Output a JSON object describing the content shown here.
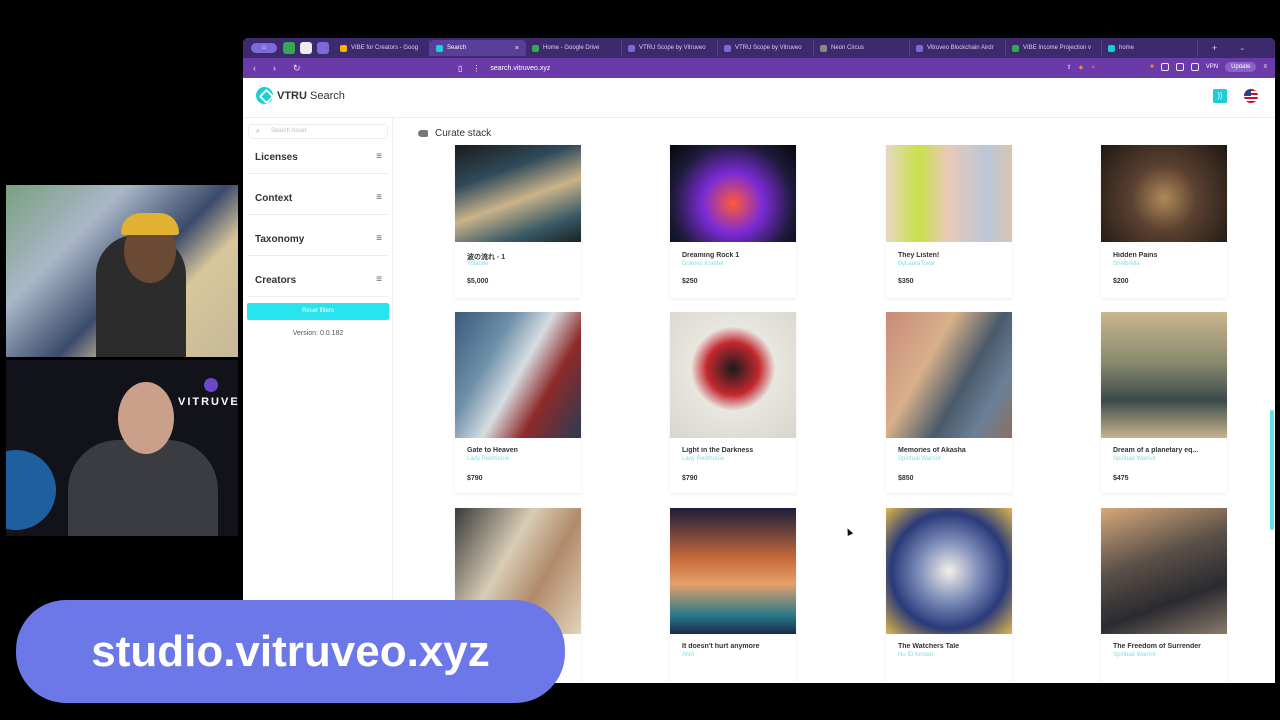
{
  "browser": {
    "win_label": "⌂",
    "tabs": [
      {
        "label": "VIBE for Creators - Goog",
        "color": "#f4b400"
      },
      {
        "label": "Search",
        "color": "#1ccdd8",
        "active": true
      },
      {
        "label": "Home - Google Drive",
        "color": "#34a853"
      },
      {
        "label": "VTRU Scope by Vitruveo",
        "color": "#7b6ad8"
      },
      {
        "label": "VTRU Scope by Vitruveo",
        "color": "#7b6ad8"
      },
      {
        "label": "Neon Circus",
        "color": "#888888"
      },
      {
        "label": "Vitruveo Blockchain Airdr",
        "color": "#7b6ad8"
      },
      {
        "label": "VIBE Income Projection v",
        "color": "#34a853"
      },
      {
        "label": "home",
        "color": "#1ccdd8"
      }
    ],
    "url": "search.vitruveo.xyz",
    "vpn_label": "VPN",
    "update_label": "Update"
  },
  "header": {
    "brand_bold": "VTRU",
    "brand_rest": " Search"
  },
  "sidebar": {
    "search_placeholder": "Search Asset",
    "facets": [
      "Licenses",
      "Context",
      "Taxonomy",
      "Creators"
    ],
    "reset_label": "Reset filters",
    "version": "Version: 0.0.182"
  },
  "main": {
    "curate_label": "Curate stack",
    "cards": [
      {
        "title": "波の流れ - 1",
        "creator": "Yolande",
        "price": "$5,000",
        "art": "linear-gradient(160deg,#1b1b1b 0%,#2f4a5a 30%,#c9b38a 55%,#3a5a66 80%,#1a2226 100%)"
      },
      {
        "title": "Dreaming Rock 1",
        "creator": "Dolores Krantel",
        "price": "$250",
        "art": "radial-gradient(circle at 50% 60%,#ff5a3a 0%,#7b2bd6 35%,#1d1b3a 70%,#05060f 100%)"
      },
      {
        "title": "They Listen!",
        "creator": "ByLauraTovar",
        "price": "$350",
        "art": "linear-gradient(90deg,#e7d7c5 0%,#c9e04a 25%,#e8c9b8 50%,#bcc6d8 80%,#d9c6b2 100%)"
      },
      {
        "title": "Hidden Pains",
        "creator": "Shelbrella",
        "price": "$200",
        "art": "radial-gradient(circle at 50% 55%,#b08a5a 0%,#5a4030 40%,#1e1812 100%)"
      },
      {
        "title": "Gate to Heaven",
        "creator": "Lady Redmonie",
        "price": "$790",
        "art": "linear-gradient(120deg,#3a5a7a 0%,#6d8fa8 30%,#d6dde2 50%,#8e2a2a 70%,#2a3b52 100%)"
      },
      {
        "title": "Light in the Darkness",
        "creator": "Lady Redmonie",
        "price": "$790",
        "art": "radial-gradient(circle at 50% 45%,#1b1b1b 0%,#c3282e 28%,#e9e6e0 45%,#d8d5cf 100%)"
      },
      {
        "title": "Memories of Akasha",
        "creator": "Spiritual Warrior",
        "price": "$850",
        "art": "linear-gradient(120deg,#c98a7a 0%,#d8b08a 35%,#4a5a6a 60%,#6a8098 80%,#8a7060 100%)"
      },
      {
        "title": "Dream of a planetary eq...",
        "creator": "Spiritual Warrior",
        "price": "$475",
        "art": "linear-gradient(180deg,#c9b68e 0%,#8a8a6e 40%,#3a4a4a 70%,#c8b490 100%)"
      },
      {
        "title": "",
        "creator": "",
        "price": "",
        "art": "linear-gradient(120deg,#3a3a3a 0%,#d8cdb5 40%,#b08a6a 65%,#e2d4bb 100%)"
      },
      {
        "title": "It doesn't hurt anymore",
        "creator": "ANA",
        "price": "",
        "art": "linear-gradient(180deg,#1b1e3a 0%,#c86a3a 40%,#e5a06a 60%,#2a7a8a 85%,#1a2a4a 100%)"
      },
      {
        "title": "The Watchers Tale",
        "creator": "No ID Known",
        "price": "",
        "art": "radial-gradient(circle at 50% 50%,#f3f0e8 0%,#7a8ab8 35%,#2a3a7a 65%,#e0b84a 100%)"
      },
      {
        "title": "The Freedom of Surrender",
        "creator": "Spiritual Warrior",
        "price": "",
        "art": "linear-gradient(160deg,#d8a87a 0%,#5a5048 40%,#2a2a30 70%,#8a7a6a 100%)"
      }
    ]
  },
  "overlay": {
    "brand": "VITRUVE",
    "banner": "studio.vitruveo.xyz"
  }
}
